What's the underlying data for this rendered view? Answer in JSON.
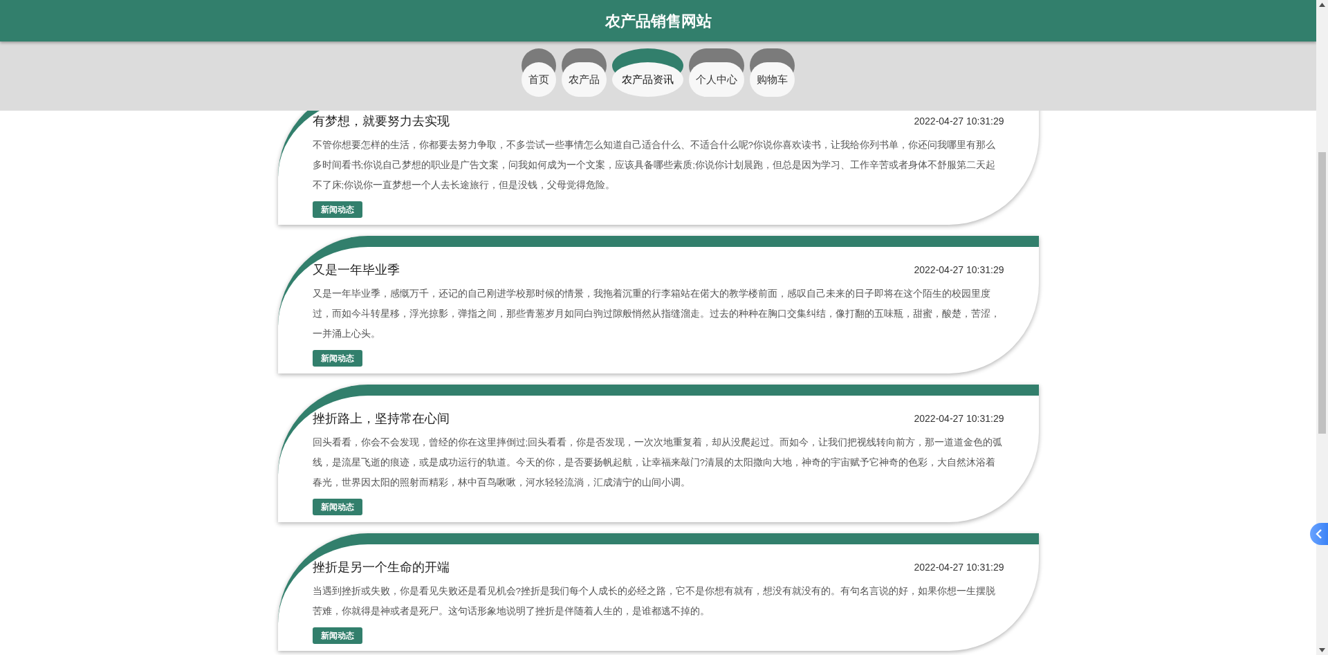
{
  "site_title": "农产品销售网站",
  "nav": [
    {
      "label": "首页",
      "selected": false
    },
    {
      "label": "农产品",
      "selected": false
    },
    {
      "label": "农产品资讯",
      "selected": true
    },
    {
      "label": "个人中心",
      "selected": false
    },
    {
      "label": "购物车",
      "selected": false
    }
  ],
  "news": [
    {
      "title": "有梦想，就要努力去实现",
      "date": "2022-04-27 10:31:29",
      "body": "不管你想要怎样的生活，你都要去努力争取，不多尝试一些事情怎么知道自己适合什么、不适合什么呢?你说你喜欢读书，让我给你列书单，你还问我哪里有那么多时间看书;你说自己梦想的职业是广告文案，问我如何成为一个文案，应该具备哪些素质;你说你计划晨跑，但总是因为学习、工作辛苦或者身体不舒服第二天起不了床;你说你一直梦想一个人去长途旅行，但是没钱，父母觉得危险。",
      "tag": "新闻动态"
    },
    {
      "title": "又是一年毕业季",
      "date": "2022-04-27 10:31:29",
      "body": "又是一年毕业季，感慨万千，还记的自己刚进学校那时候的情景，我拖着沉重的行李箱站在偌大的教学楼前面，感叹自己未来的日子即将在这个陌生的校园里度过，而如今斗转星移，浮光掠影，弹指之间，那些青葱岁月如同白驹过隙般悄然从指缝溜走。过去的种种在胸口交集纠结，像打翻的五味瓶，甜蜜，酸楚，苦涩，一并涌上心头。",
      "tag": "新闻动态"
    },
    {
      "title": "挫折路上，坚持常在心间",
      "date": "2022-04-27 10:31:29",
      "body": "回头看看，你会不会发现，曾经的你在这里摔倒过;回头看看，你是否发现，一次次地重复着，却从没爬起过。而如今，让我们把视线转向前方，那一道道金色的弧线，是流星飞逝的痕迹，或是成功运行的轨道。今天的你，是否要扬帆起航，让幸福来敲门?清晨的太阳撒向大地，神奇的宇宙赋予它神奇的色彩，大自然沐浴着春光，世界因太阳的照射而精彩，林中百鸟啾啾，河水轻轻流淌，汇成清宁的山间小调。",
      "tag": "新闻动态"
    },
    {
      "title": "挫折是另一个生命的开端",
      "date": "2022-04-27 10:31:29",
      "body": "当遇到挫折或失败，你是看见失败还是看见机会?挫折是我们每个人成长的必经之路，它不是你想有就有，想没有就没有的。有句名言说的好，如果你想一生摆脱苦难，你就得是神或者是死尸。这句话形象地说明了挫折是伴随着人生的，是谁都逃不掉的。",
      "tag": "新闻动态"
    }
  ]
}
